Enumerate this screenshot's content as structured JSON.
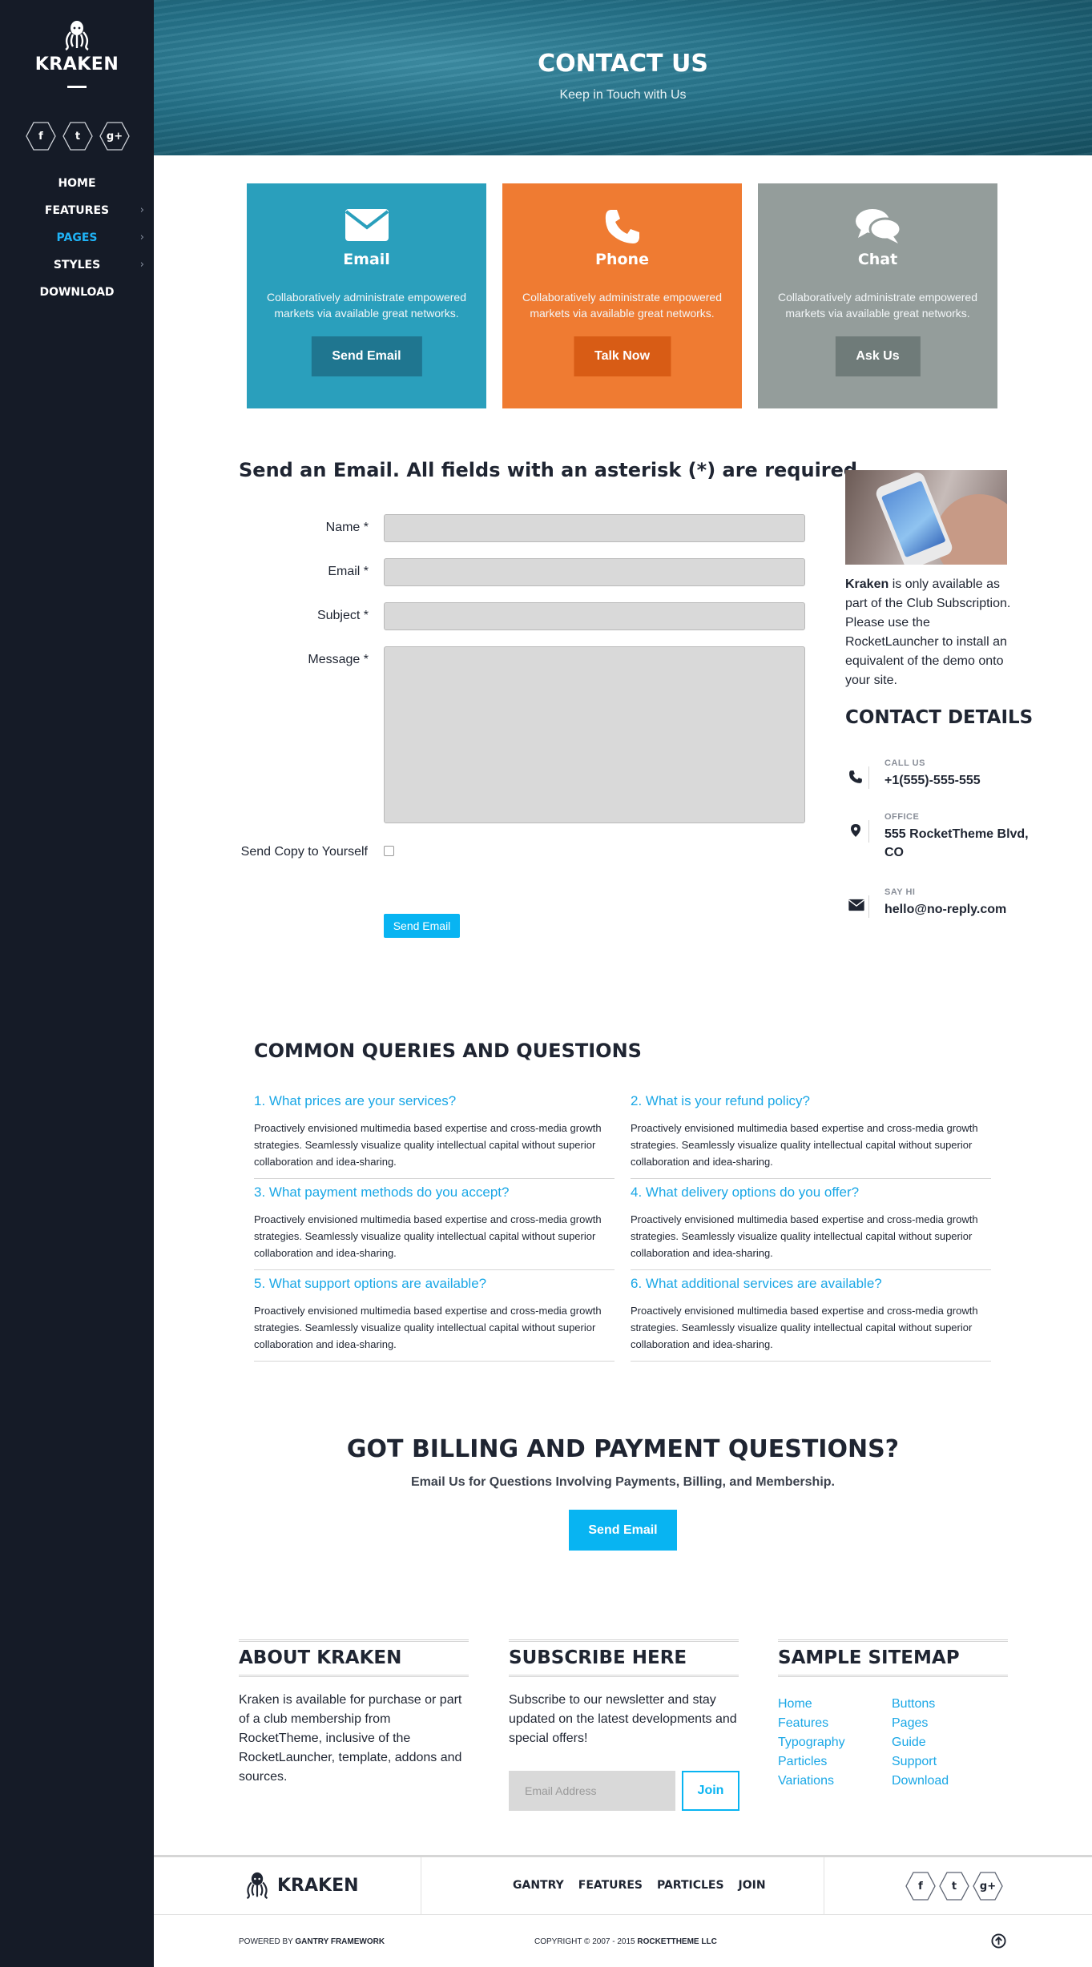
{
  "sidebar": {
    "logo_text": "KRAKEN",
    "social": [
      {
        "icon": "facebook-icon",
        "glyph": "f"
      },
      {
        "icon": "twitter-icon",
        "glyph": "t"
      },
      {
        "icon": "google-plus-icon",
        "glyph": "g+"
      }
    ],
    "nav": [
      {
        "label": "HOME",
        "has_children": false,
        "active": false
      },
      {
        "label": "FEATURES",
        "has_children": true,
        "active": false
      },
      {
        "label": "PAGES",
        "has_children": true,
        "active": true
      },
      {
        "label": "STYLES",
        "has_children": true,
        "active": false
      },
      {
        "label": "DOWNLOAD",
        "has_children": false,
        "active": false
      }
    ],
    "chevron": "›"
  },
  "hero": {
    "title": "CONTACT US",
    "subtitle": "Keep in Touch with Us"
  },
  "cards": [
    {
      "icon": "envelope-icon",
      "title": "Email",
      "desc": "Collaboratively administrate empowered markets via available great networks.",
      "button": "Send Email",
      "color": "#2a9fbc",
      "button_color": "#1f7690"
    },
    {
      "icon": "phone-icon",
      "title": "Phone",
      "desc": "Collaboratively administrate empowered markets via available great networks.",
      "button": "Talk Now",
      "color": "#ef7b32",
      "button_color": "#d85c15"
    },
    {
      "icon": "chat-icon",
      "title": "Chat",
      "desc": "Collaboratively administrate empowered markets via available great networks.",
      "button": "Ask Us",
      "color": "#949d9b",
      "button_color": "#6f7b79"
    }
  ],
  "form": {
    "title": "Send an Email. All fields with an asterisk (*) are required.",
    "name_label": "Name *",
    "email_label": "Email *",
    "subject_label": "Subject *",
    "message_label": "Message *",
    "copy_label": "Send Copy to Yourself",
    "submit_label": "Send Email"
  },
  "aside": {
    "brand": "Kraken",
    "text": " is only available as part of the Club Subscription. Please use the RocketLauncher to install an equivalent of the demo onto your site.",
    "contact_title": "CONTACT DETAILS",
    "contacts": [
      {
        "icon": "phone-icon",
        "label": "CALL US",
        "value": "+1(555)-555-555"
      },
      {
        "icon": "map-marker-icon",
        "label": "OFFICE",
        "value": "555 RocketTheme Blvd, CO"
      },
      {
        "icon": "envelope-icon",
        "label": "SAY HI",
        "value": "hello@no-reply.com"
      }
    ]
  },
  "faq": {
    "title": "COMMON QUERIES AND QUESTIONS",
    "items": [
      {
        "q": "1. What prices are your services?",
        "a": "Proactively envisioned multimedia based expertise and cross-media growth strategies. Seamlessly visualize quality intellectual capital without superior collaboration and idea-sharing."
      },
      {
        "q": "2. What is your refund policy?",
        "a": "Proactively envisioned multimedia based expertise and cross-media growth strategies. Seamlessly visualize quality intellectual capital without superior collaboration and idea-sharing."
      },
      {
        "q": "3. What payment methods do you accept?",
        "a": "Proactively envisioned multimedia based expertise and cross-media growth strategies. Seamlessly visualize quality intellectual capital without superior collaboration and idea-sharing."
      },
      {
        "q": "4. What delivery options do you offer?",
        "a": "Proactively envisioned multimedia based expertise and cross-media growth strategies. Seamlessly visualize quality intellectual capital without superior collaboration and idea-sharing."
      },
      {
        "q": "5. What support options are available?",
        "a": "Proactively envisioned multimedia based expertise and cross-media growth strategies. Seamlessly visualize quality intellectual capital without superior collaboration and idea-sharing."
      },
      {
        "q": "6. What additional services are available?",
        "a": "Proactively envisioned multimedia based expertise and cross-media growth strategies. Seamlessly visualize quality intellectual capital without superior collaboration and idea-sharing."
      }
    ]
  },
  "billing": {
    "title": "GOT BILLING AND PAYMENT QUESTIONS?",
    "subtitle": "Email Us for Questions Involving Payments, Billing, and Membership.",
    "button": "Send Email"
  },
  "footer": {
    "about_title": "ABOUT KRAKEN",
    "about_text": "Kraken is available for purchase or part of a club membership from RocketTheme, inclusive of the RocketLauncher, template, addons and sources.",
    "subscribe_title": "SUBSCRIBE HERE",
    "subscribe_text": "Subscribe to our newsletter and stay updated on the latest developments and special offers!",
    "email_placeholder": "Email Address",
    "join_label": "Join",
    "sitemap_title": "SAMPLE SITEMAP",
    "sitemap_col1": [
      "Home",
      "Features",
      "Typography",
      "Particles",
      "Variations"
    ],
    "sitemap_col2": [
      "Buttons",
      "Pages",
      "Guide",
      "Support",
      "Download"
    ]
  },
  "bottom": {
    "logo_text": "KRAKEN",
    "nav": [
      "GANTRY",
      "FEATURES",
      "PARTICLES",
      "JOIN"
    ],
    "powered_prefix": "POWERED BY ",
    "powered_name": "GANTRY FRAMEWORK",
    "copyright_prefix": "COPYRIGHT © 2007 - 2015 ",
    "copyright_name": "ROCKETTHEME LLC"
  },
  "colors": {
    "accent": "#08b4f2",
    "link": "#1aa7e6",
    "sidebar_bg": "#151b27"
  }
}
